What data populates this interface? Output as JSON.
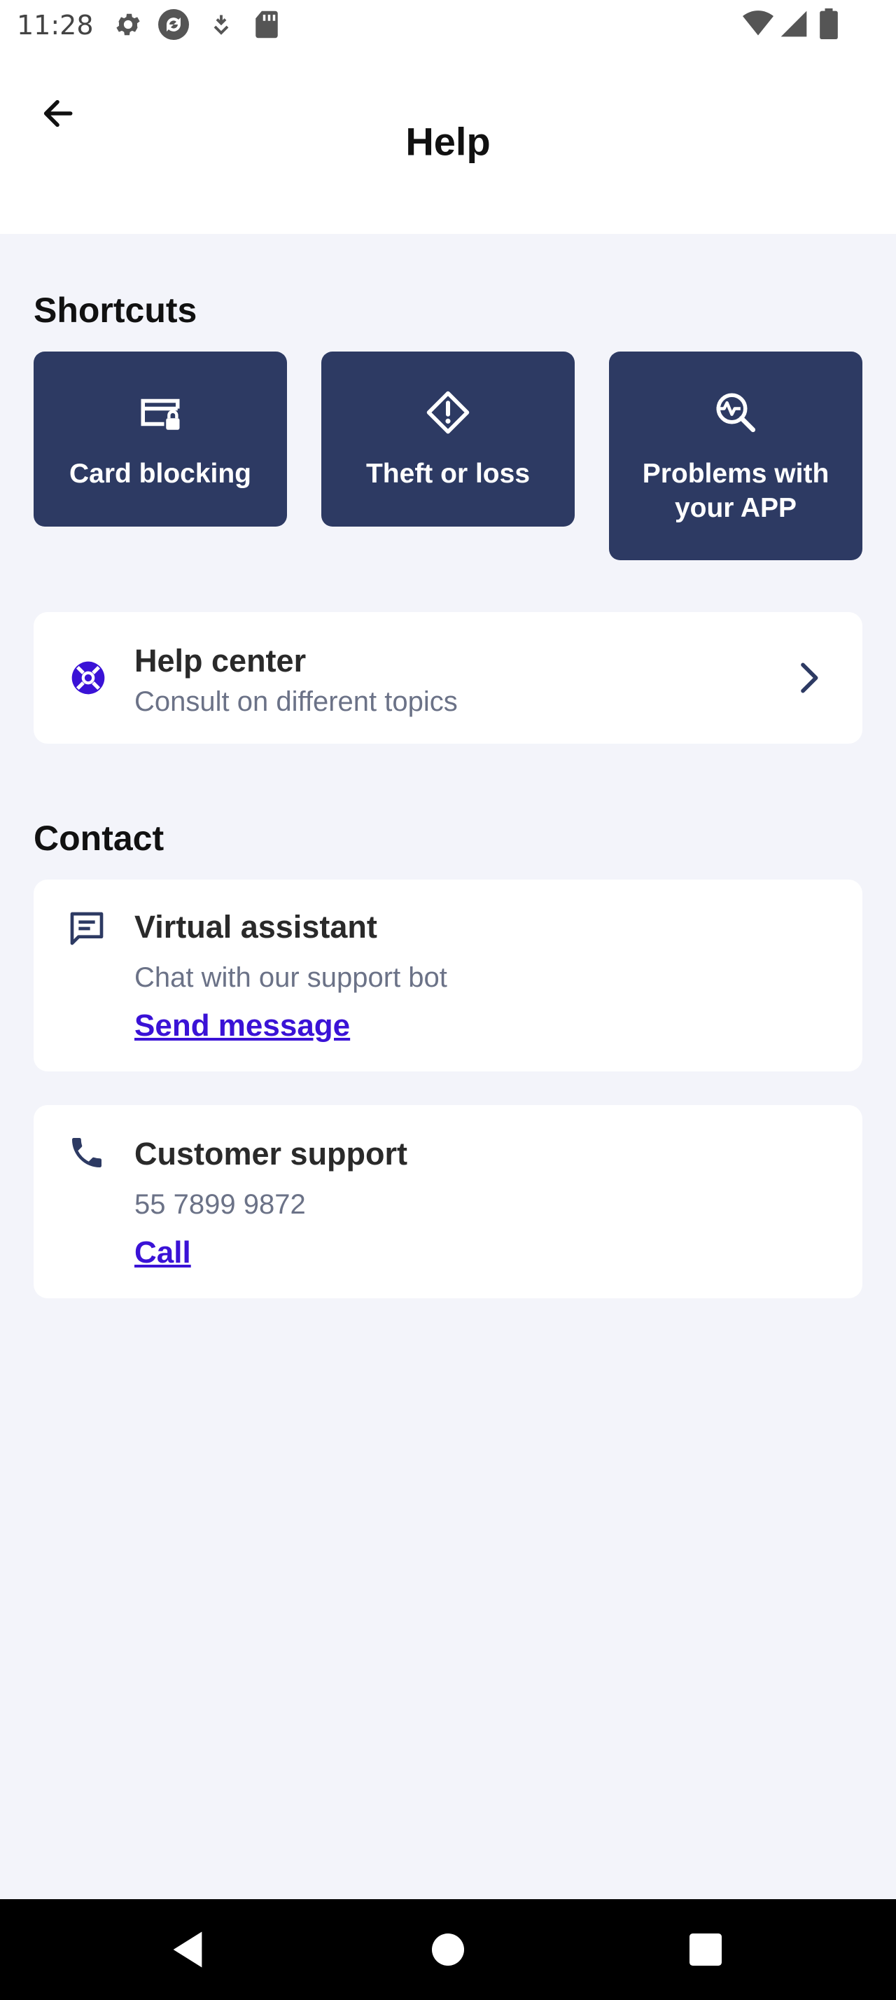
{
  "status_bar": {
    "time": "11:28",
    "icons_left": [
      "settings-icon",
      "sync-icon",
      "download-icon",
      "sd-card-icon"
    ],
    "icons_right": [
      "wifi-icon",
      "signal-icon",
      "battery-icon"
    ]
  },
  "header": {
    "title": "Help",
    "back_icon": "arrow-left-icon"
  },
  "shortcuts": {
    "title": "Shortcuts",
    "items": [
      {
        "label": "Card blocking",
        "icon": "card-lock-icon"
      },
      {
        "label": "Theft or loss",
        "icon": "warning-diamond-icon"
      },
      {
        "label": "Problems with your APP",
        "icon": "search-pulse-icon"
      }
    ]
  },
  "help_center": {
    "title": "Help center",
    "subtitle": "Consult on different topics",
    "icon": "lifebuoy-icon",
    "chevron": "chevron-right-icon"
  },
  "contact": {
    "title": "Contact",
    "items": [
      {
        "title": "Virtual assistant",
        "subtitle": "Chat with our support bot",
        "link": "Send message",
        "icon": "chat-icon"
      },
      {
        "title": "Customer support",
        "subtitle": "55 7899 9872",
        "link": "Call",
        "icon": "phone-icon"
      }
    ]
  },
  "colors": {
    "tile_bg": "#2d3a63",
    "link": "#3a12d6",
    "page_bg": "#f3f4fa"
  },
  "nav_bar": {
    "buttons": [
      "back-triangle-icon",
      "home-circle-icon",
      "recents-square-icon"
    ]
  }
}
